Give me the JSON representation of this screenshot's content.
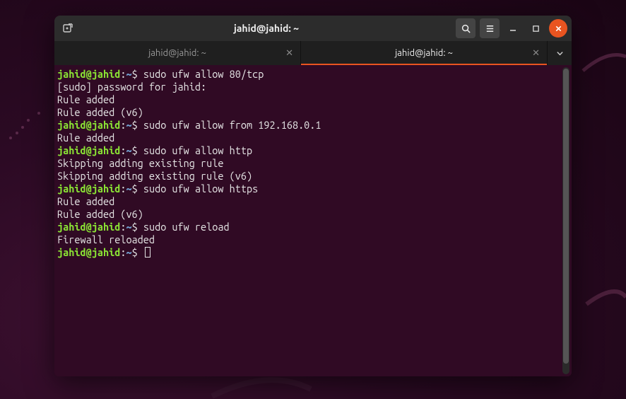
{
  "colors": {
    "accent": "#e95420",
    "prompt_user": "#8ae234",
    "prompt_path": "#729fcf",
    "term_bg": "#300a24"
  },
  "titlebar": {
    "title": "jahid@jahid: ~"
  },
  "tabs": [
    {
      "label": "jahid@jahid: ~",
      "active": false
    },
    {
      "label": "jahid@jahid: ~",
      "active": true
    }
  ],
  "terminal": {
    "prompt_user": "jahid@jahid",
    "prompt_sep": ":",
    "prompt_path": "~",
    "prompt_char": "$",
    "lines": [
      {
        "type": "cmd",
        "text": "sudo ufw allow 80/tcp"
      },
      {
        "type": "out",
        "text": "[sudo] password for jahid:"
      },
      {
        "type": "out",
        "text": "Rule added"
      },
      {
        "type": "out",
        "text": "Rule added (v6)"
      },
      {
        "type": "cmd",
        "text": "sudo ufw allow from 192.168.0.1"
      },
      {
        "type": "out",
        "text": "Rule added"
      },
      {
        "type": "cmd",
        "text": "sudo ufw allow http"
      },
      {
        "type": "out",
        "text": "Skipping adding existing rule"
      },
      {
        "type": "out",
        "text": "Skipping adding existing rule (v6)"
      },
      {
        "type": "cmd",
        "text": "sudo ufw allow https"
      },
      {
        "type": "out",
        "text": "Rule added"
      },
      {
        "type": "out",
        "text": "Rule added (v6)"
      },
      {
        "type": "cmd",
        "text": "sudo ufw reload"
      },
      {
        "type": "out",
        "text": "Firewall reloaded"
      },
      {
        "type": "cmd",
        "text": "",
        "cursor": true
      }
    ]
  }
}
